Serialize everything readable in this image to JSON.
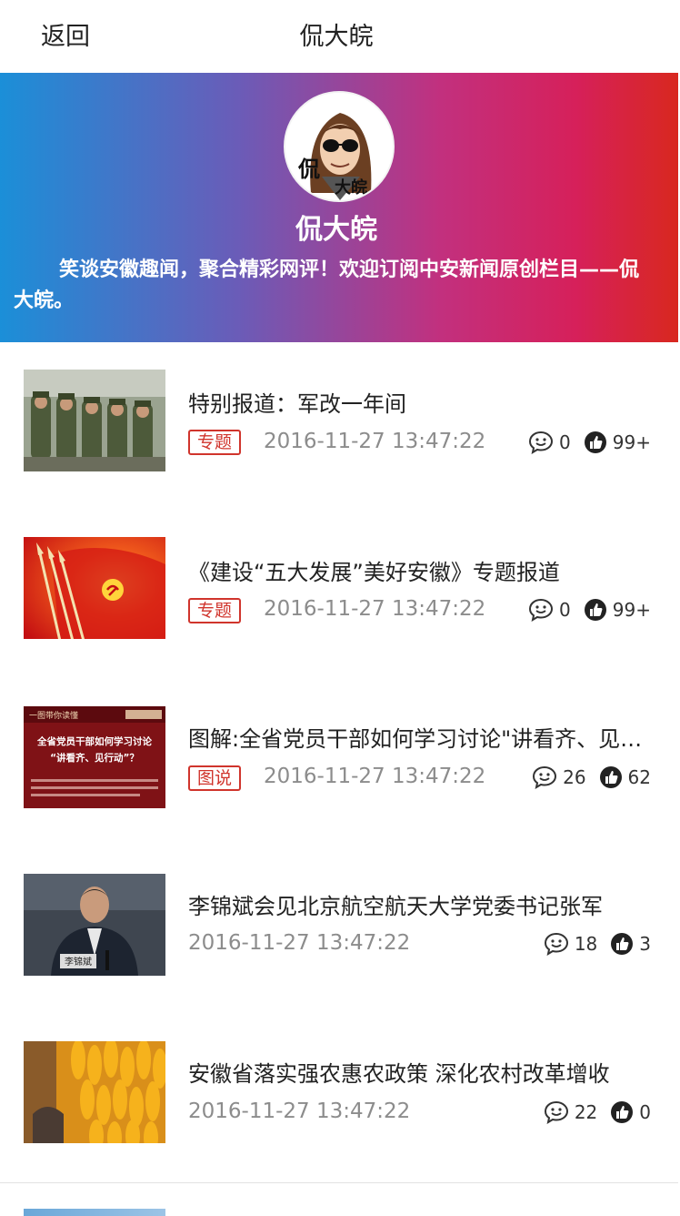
{
  "header": {
    "back_label": "返回",
    "title": "侃大皖"
  },
  "banner": {
    "name": "侃大皖",
    "description": "笑谈安徽趣闻，聚合精彩网评！欢迎订阅中安新闻原创栏目——侃大皖。",
    "avatar_text": "侃大皖"
  },
  "articles": [
    {
      "title": "特别报道：军改一年间",
      "tag": "专题",
      "time": "2016-11-27 13:47:22",
      "comments": "0",
      "likes": "99+"
    },
    {
      "title": "《建设“五大发展”美好安徽》专题报道",
      "tag": "专题",
      "time": "2016-11-27 13:47:22",
      "comments": "0",
      "likes": "99+"
    },
    {
      "title": "图解:全省党员干部如何学习讨论\"讲看齐、见行动\"",
      "tag": "图说",
      "time": "2016-11-27 13:47:22",
      "comments": "26",
      "likes": "62",
      "thumb_header": "一图带你读懂",
      "thumb_line1": "全省党员干部如何学习讨论",
      "thumb_line2": "“讲看齐、见行动”？"
    },
    {
      "title": "李锦斌会见北京航空航天大学党委书记张军",
      "tag": "",
      "time": "2016-11-27 13:47:22",
      "comments": "18",
      "likes": "3",
      "thumb_caption": "李锦斌"
    },
    {
      "title": "安徽省落实强农惠农政策 深化农村改革增收",
      "tag": "",
      "time": "2016-11-27 13:47:22",
      "comments": "22",
      "likes": "0"
    }
  ],
  "colors": {
    "accent_red": "#d0342c",
    "banner_start": "#1b8fd8",
    "banner_end": "#d8281f"
  }
}
